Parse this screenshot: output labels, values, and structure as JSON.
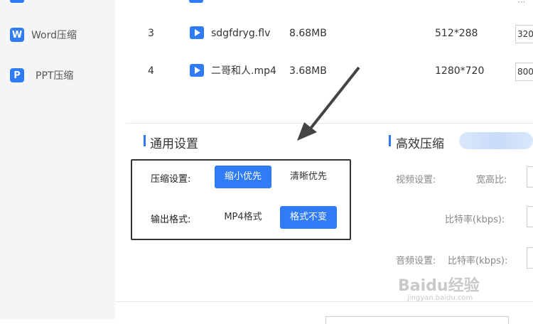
{
  "sidebar": {
    "items": [
      {
        "label": "Word压缩",
        "icon": "word-icon",
        "glyph": "W"
      },
      {
        "label": "PPT压缩",
        "icon": "ppt-icon",
        "glyph": "P"
      }
    ]
  },
  "files": [
    {
      "index": "3",
      "name": "sdgfdryg.flv",
      "size": "8.68MB",
      "resolution": "512*288",
      "ratio": "320"
    },
    {
      "index": "4",
      "name": "二哥和人.mp4",
      "size": "3.68MB",
      "resolution": "1280*720",
      "ratio": "800"
    }
  ],
  "general_settings": {
    "title": "通用设置",
    "compress_label": "压缩设置:",
    "compress_options": [
      "缩小优先",
      "清晰优先"
    ],
    "compress_selected": "缩小优先",
    "format_label": "输出格式:",
    "format_options": [
      "MP4格式",
      "格式不变"
    ],
    "format_selected": "格式不变"
  },
  "efficient": {
    "title": "高效压缩",
    "video_label": "视频设置:",
    "aspect_label": "宽高比:",
    "bitrate_label": "比特率(kbps):",
    "audio_label": "音频设置:",
    "audio_bitrate_label": "比特率(kbps):"
  },
  "watermark": {
    "main": "Baidu经验",
    "sub": "jingyan.baidu.com"
  },
  "colors": {
    "accent": "#2f7cf6",
    "sidebar_bg": "#f4f5f7",
    "highlight_border": "#333333"
  }
}
